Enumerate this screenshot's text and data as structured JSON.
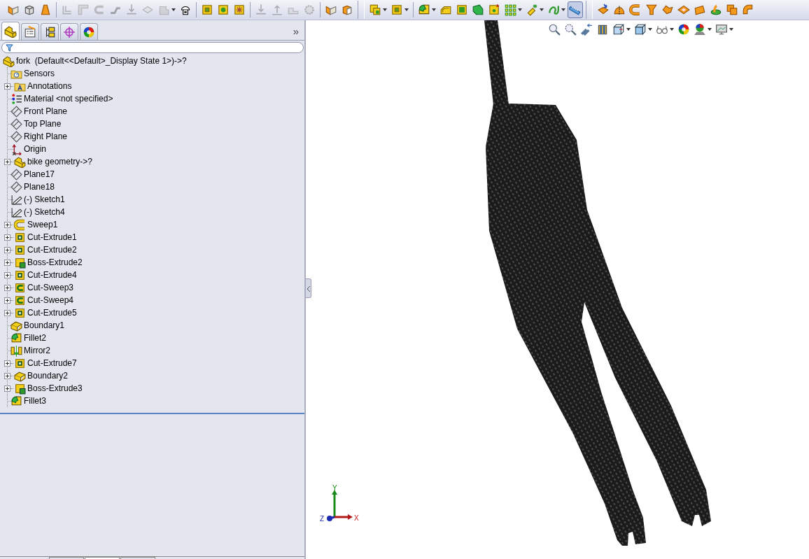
{
  "toolbar": {
    "buttons": [
      {
        "kind": "fold",
        "disabled": false,
        "dropdown": false,
        "selected": false
      },
      {
        "kind": "cube",
        "disabled": false,
        "dropdown": false,
        "selected": false
      },
      {
        "kind": "cone",
        "disabled": false,
        "dropdown": false,
        "selected": false
      },
      {
        "kind": "separator"
      },
      {
        "kind": "bend",
        "disabled": true,
        "dropdown": false,
        "selected": false
      },
      {
        "kind": "corner",
        "disabled": true,
        "dropdown": false,
        "selected": false
      },
      {
        "kind": "hook",
        "disabled": true,
        "dropdown": false,
        "selected": false
      },
      {
        "kind": "jog",
        "disabled": true,
        "dropdown": false,
        "selected": false
      },
      {
        "kind": "arrow-down",
        "disabled": true,
        "dropdown": false,
        "selected": false
      },
      {
        "kind": "diamond",
        "disabled": true,
        "dropdown": false,
        "selected": false
      },
      {
        "kind": "block",
        "disabled": true,
        "dropdown": true,
        "selected": false
      },
      {
        "kind": "hood",
        "disabled": false,
        "dropdown": false,
        "selected": false
      },
      {
        "kind": "separator"
      },
      {
        "kind": "box",
        "disabled": false,
        "dropdown": false,
        "selected": false
      },
      {
        "kind": "box-circle",
        "disabled": false,
        "dropdown": false,
        "selected": false
      },
      {
        "kind": "box-grid",
        "disabled": false,
        "dropdown": false,
        "selected": false
      },
      {
        "kind": "separator"
      },
      {
        "kind": "arrow-down",
        "disabled": true,
        "dropdown": false,
        "selected": false
      },
      {
        "kind": "arrow-up",
        "disabled": true,
        "dropdown": false,
        "selected": false
      },
      {
        "kind": "flat",
        "disabled": true,
        "dropdown": false,
        "selected": false
      },
      {
        "kind": "gear",
        "disabled": true,
        "dropdown": false,
        "selected": false
      },
      {
        "kind": "separator"
      },
      {
        "kind": "fold",
        "disabled": false,
        "dropdown": false,
        "selected": false
      },
      {
        "kind": "cube-orange",
        "disabled": false,
        "dropdown": false,
        "selected": false
      },
      {
        "kind": "gap"
      },
      {
        "kind": "box-stack",
        "disabled": false,
        "dropdown": true,
        "selected": false
      },
      {
        "kind": "box",
        "disabled": false,
        "dropdown": true,
        "selected": false
      },
      {
        "kind": "separator"
      },
      {
        "kind": "fillet",
        "disabled": false,
        "dropdown": true,
        "selected": false
      },
      {
        "kind": "chamfer",
        "disabled": false,
        "dropdown": false,
        "selected": false
      },
      {
        "kind": "box-green",
        "disabled": false,
        "dropdown": false,
        "selected": false
      },
      {
        "kind": "wedge",
        "disabled": false,
        "dropdown": false,
        "selected": false
      },
      {
        "kind": "box-spark",
        "disabled": false,
        "dropdown": false,
        "selected": false
      },
      {
        "kind": "pattern",
        "disabled": false,
        "dropdown": true,
        "selected": false
      },
      {
        "kind": "spark",
        "disabled": false,
        "dropdown": true,
        "selected": false
      },
      {
        "kind": "curve",
        "disabled": false,
        "dropdown": true,
        "selected": false
      },
      {
        "kind": "ruler",
        "disabled": false,
        "dropdown": false,
        "selected": true
      },
      {
        "kind": "gap"
      },
      {
        "kind": "sheet-arrow",
        "disabled": false,
        "dropdown": false,
        "selected": false
      },
      {
        "kind": "dome",
        "disabled": false,
        "dropdown": false,
        "selected": false
      },
      {
        "kind": "hook-orange",
        "disabled": false,
        "dropdown": false,
        "selected": false
      },
      {
        "kind": "funnel-orange",
        "disabled": false,
        "dropdown": false,
        "selected": false
      },
      {
        "kind": "patch",
        "disabled": false,
        "dropdown": false,
        "selected": false
      },
      {
        "kind": "diamond-orange",
        "disabled": false,
        "dropdown": false,
        "selected": false
      },
      {
        "kind": "sheet",
        "disabled": false,
        "dropdown": false,
        "selected": false
      },
      {
        "kind": "blob",
        "disabled": false,
        "dropdown": false,
        "selected": false
      },
      {
        "kind": "sheet-stack",
        "disabled": false,
        "dropdown": false,
        "selected": false
      },
      {
        "kind": "pipe",
        "disabled": false,
        "dropdown": false,
        "selected": false
      }
    ]
  },
  "panel": {
    "tabs": [
      {
        "kind": "feature-tree",
        "selected": true
      },
      {
        "kind": "properties",
        "selected": false
      },
      {
        "kind": "configurations",
        "selected": false
      },
      {
        "kind": "crosshair",
        "selected": false
      },
      {
        "kind": "appearance",
        "selected": false
      }
    ],
    "expand_glyph": "»"
  },
  "tree": {
    "root": {
      "label": "fork  (Default<<Default>_Display State 1>)->?",
      "kind": "part"
    },
    "items": [
      {
        "label": "Sensors",
        "kind": "sensor-folder",
        "expandable": false
      },
      {
        "label": "Annotations",
        "kind": "annotation-folder",
        "expandable": true
      },
      {
        "label": "Material <not specified>",
        "kind": "material",
        "expandable": false
      },
      {
        "label": "Front Plane",
        "kind": "plane",
        "expandable": false
      },
      {
        "label": "Top Plane",
        "kind": "plane",
        "expandable": false
      },
      {
        "label": "Right Plane",
        "kind": "plane",
        "expandable": false
      },
      {
        "label": "Origin",
        "kind": "origin",
        "expandable": false
      },
      {
        "label": "bike geometry->?",
        "kind": "part",
        "expandable": true
      },
      {
        "label": "Plane17",
        "kind": "plane",
        "expandable": false
      },
      {
        "label": "Plane18",
        "kind": "plane",
        "expandable": false
      },
      {
        "label": "(-) Sketch1",
        "kind": "sketch",
        "expandable": false
      },
      {
        "label": "(-) Sketch4",
        "kind": "sketch",
        "expandable": false
      },
      {
        "label": "Sweep1",
        "kind": "sweep",
        "expandable": true
      },
      {
        "label": "Cut-Extrude1",
        "kind": "cut-extrude",
        "expandable": true
      },
      {
        "label": "Cut-Extrude2",
        "kind": "cut-extrude",
        "expandable": true
      },
      {
        "label": "Boss-Extrude2",
        "kind": "boss-extrude",
        "expandable": true
      },
      {
        "label": "Cut-Extrude4",
        "kind": "cut-extrude",
        "expandable": true
      },
      {
        "label": "Cut-Sweep3",
        "kind": "cut-sweep",
        "expandable": true
      },
      {
        "label": "Cut-Sweep4",
        "kind": "cut-sweep",
        "expandable": true
      },
      {
        "label": "Cut-Extrude5",
        "kind": "cut-extrude",
        "expandable": true
      },
      {
        "label": "Boundary1",
        "kind": "boundary",
        "expandable": false
      },
      {
        "label": "Fillet2",
        "kind": "fillet",
        "expandable": false
      },
      {
        "label": "Mirror2",
        "kind": "mirror",
        "expandable": false
      },
      {
        "label": "Cut-Extrude7",
        "kind": "cut-extrude",
        "expandable": true
      },
      {
        "label": "Boundary2",
        "kind": "boundary",
        "expandable": true
      },
      {
        "label": "Boss-Extrude3",
        "kind": "boss-extrude",
        "expandable": true
      },
      {
        "label": "Fillet3",
        "kind": "fillet",
        "expandable": false
      }
    ]
  },
  "view_toolbar": {
    "buttons": [
      {
        "kind": "zoom-fit",
        "dropdown": false
      },
      {
        "kind": "zoom-area",
        "dropdown": false
      },
      {
        "kind": "previous-view",
        "dropdown": false
      },
      {
        "kind": "section",
        "dropdown": false
      },
      {
        "kind": "view-orientation",
        "dropdown": true
      },
      {
        "kind": "display-style",
        "dropdown": true
      },
      {
        "kind": "glasses",
        "dropdown": true
      },
      {
        "kind": "color-ball",
        "dropdown": false
      },
      {
        "kind": "scene",
        "dropdown": true
      },
      {
        "kind": "monitor",
        "dropdown": true
      }
    ]
  },
  "triad": {
    "x": "X",
    "y": "Y",
    "z": "Z"
  },
  "bottom_tabs": [
    {
      "selected": false
    },
    {
      "selected": true
    },
    {
      "selected": false
    }
  ]
}
